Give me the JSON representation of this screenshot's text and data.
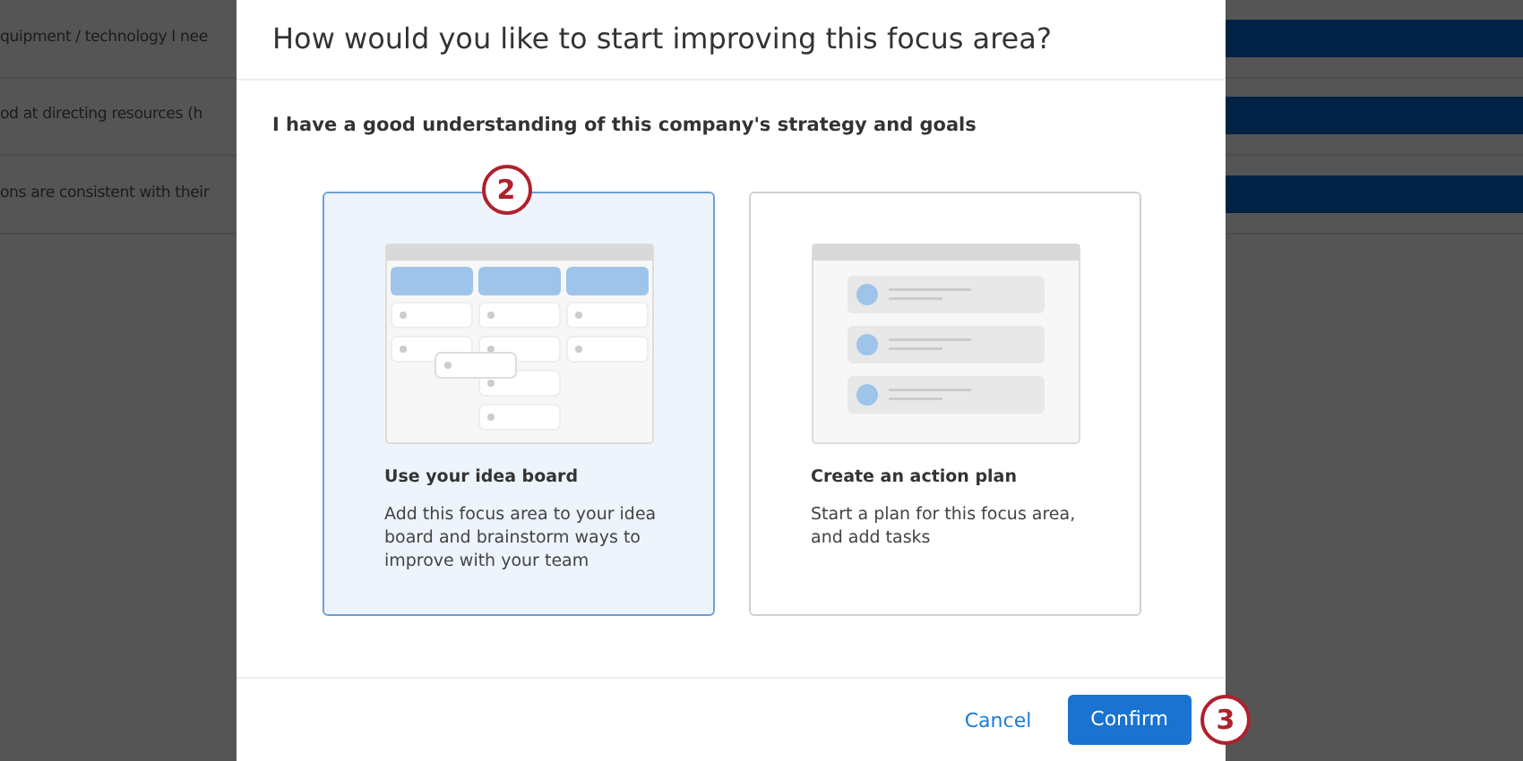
{
  "background": {
    "rows": [
      {
        "text": "quipment / technology I nee"
      },
      {
        "text": "od at directing resources (h"
      },
      {
        "text": "ons are consistent with their"
      }
    ]
  },
  "dialog": {
    "title": "How would you like to start improving this focus area?",
    "question": "I have a good understanding of this company's strategy and goals",
    "options": [
      {
        "kind": "board",
        "title": "Use your idea board",
        "description": "Add this focus area to your idea board and brainstorm ways to improve with your team",
        "selected": true,
        "callout": "2"
      },
      {
        "kind": "plan",
        "title": "Create an action plan",
        "description": "Start a plan for this focus area, and add tasks",
        "selected": false
      }
    ],
    "buttons": [
      {
        "kind": "link",
        "label": "Cancel"
      },
      {
        "kind": "primary",
        "label": "Confirm",
        "callout": "3"
      }
    ]
  }
}
